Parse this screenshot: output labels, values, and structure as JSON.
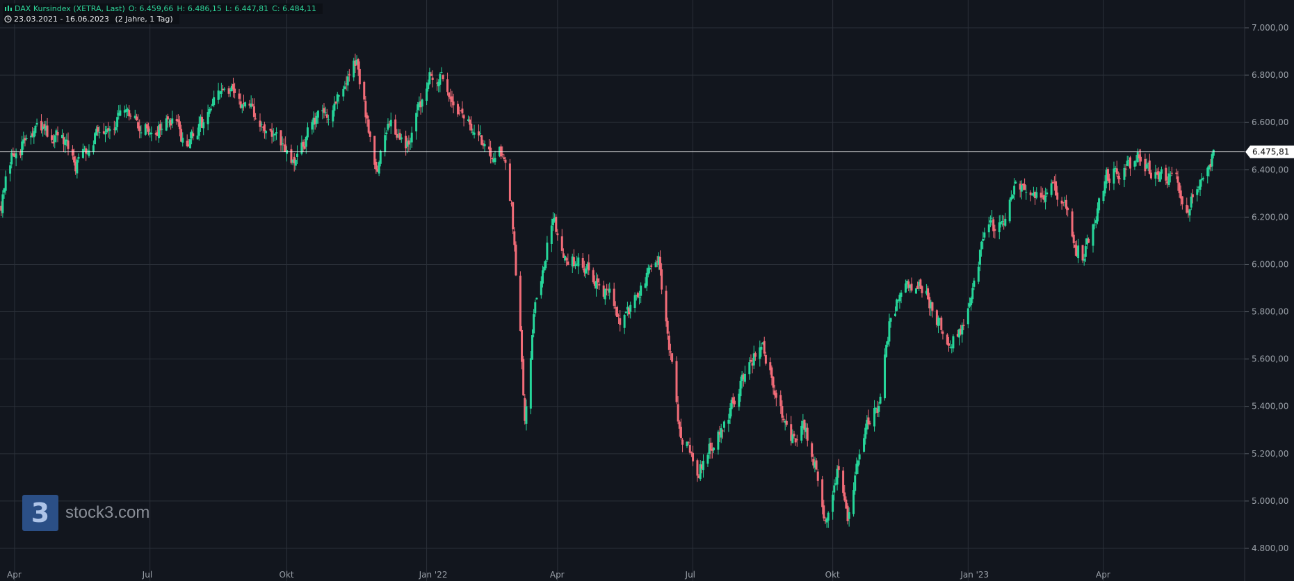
{
  "header": {
    "title": "DAX Kursindex (XETRA, Last)",
    "open": "O: 6.459,66",
    "high": "H: 6.486,15",
    "low": "L: 6.447,81",
    "close": "C: 6.484,11",
    "range": "23.03.2021 - 16.06.2023",
    "period": "(2 Jahre, 1 Tag)"
  },
  "watermark": {
    "text": "stock3.com",
    "logo": "3"
  },
  "colors": {
    "up": "#26d69a",
    "down": "#f26c78",
    "grid": "#2b3039",
    "background": "#12161e"
  },
  "chart_data": {
    "type": "candlestick",
    "title": "DAX Kursindex (XETRA, Last)",
    "ylim": [
      4800,
      7000
    ],
    "y_ticks": [
      4800,
      5000,
      5200,
      5400,
      5600,
      5800,
      6000,
      6200,
      6400,
      6600,
      6800,
      7000
    ],
    "y_tick_labels": [
      "4.800,00",
      "5.000,00",
      "5.200,00",
      "5.400,00",
      "5.600,00",
      "5.800,00",
      "6.000,00",
      "6.200,00",
      "6.400,00",
      "6.600,00",
      "6.800,00",
      "7.000,00"
    ],
    "x_ticks": [
      {
        "label": "Apr",
        "date": "2021-04-01"
      },
      {
        "label": "Jul",
        "date": "2021-07-01"
      },
      {
        "label": "Okt",
        "date": "2021-10-01"
      },
      {
        "label": "Jan '22",
        "date": "2022-01-03"
      },
      {
        "label": "Apr",
        "date": "2022-04-01"
      },
      {
        "label": "Jul",
        "date": "2022-07-01"
      },
      {
        "label": "Okt",
        "date": "2022-10-03"
      },
      {
        "label": "Jan '23",
        "date": "2023-01-02"
      },
      {
        "label": "Apr",
        "date": "2023-04-03"
      }
    ],
    "x_range": [
      "2021-03-23",
      "2023-06-16"
    ],
    "current_price": 6475.81,
    "current_price_label": "6.475,81",
    "last_candle": {
      "open": 6459.66,
      "high": 6486.15,
      "low": 6447.81,
      "close": 6484.11
    },
    "close_path": [
      [
        "2021-03-23",
        6260
      ],
      [
        "2021-04-01",
        6480
      ],
      [
        "2021-04-15",
        6560
      ],
      [
        "2021-04-30",
        6540
      ],
      [
        "2021-05-12",
        6420
      ],
      [
        "2021-05-25",
        6570
      ],
      [
        "2021-06-10",
        6620
      ],
      [
        "2021-06-30",
        6570
      ],
      [
        "2021-07-15",
        6600
      ],
      [
        "2021-07-27",
        6500
      ],
      [
        "2021-08-10",
        6640
      ],
      [
        "2021-08-20",
        6730
      ],
      [
        "2021-09-01",
        6690
      ],
      [
        "2021-09-10",
        6600
      ],
      [
        "2021-09-20",
        6560
      ],
      [
        "2021-09-30",
        6460
      ],
      [
        "2021-10-06",
        6400
      ],
      [
        "2021-10-15",
        6560
      ],
      [
        "2021-10-28",
        6640
      ],
      [
        "2021-11-10",
        6780
      ],
      [
        "2021-11-17",
        6850
      ],
      [
        "2021-11-26",
        6540
      ],
      [
        "2021-12-01",
        6400
      ],
      [
        "2021-12-10",
        6620
      ],
      [
        "2021-12-20",
        6510
      ],
      [
        "2021-12-30",
        6660
      ],
      [
        "2022-01-05",
        6830
      ],
      [
        "2022-01-20",
        6720
      ],
      [
        "2022-02-01",
        6580
      ],
      [
        "2022-02-10",
        6500
      ],
      [
        "2022-02-24",
        6480
      ],
      [
        "2022-03-01",
        6260
      ],
      [
        "2022-03-07",
        5700
      ],
      [
        "2022-03-10",
        5350
      ],
      [
        "2022-03-16",
        5800
      ],
      [
        "2022-03-29",
        6200
      ],
      [
        "2022-04-07",
        6020
      ],
      [
        "2022-04-20",
        6000
      ],
      [
        "2022-05-05",
        5880
      ],
      [
        "2022-05-12",
        5750
      ],
      [
        "2022-05-20",
        5800
      ],
      [
        "2022-06-01",
        5960
      ],
      [
        "2022-06-08",
        6000
      ],
      [
        "2022-06-16",
        5600
      ],
      [
        "2022-06-22",
        5300
      ],
      [
        "2022-07-01",
        5200
      ],
      [
        "2022-07-05",
        5130
      ],
      [
        "2022-07-15",
        5260
      ],
      [
        "2022-07-28",
        5420
      ],
      [
        "2022-08-10",
        5600
      ],
      [
        "2022-08-16",
        5660
      ],
      [
        "2022-08-29",
        5400
      ],
      [
        "2022-09-05",
        5220
      ],
      [
        "2022-09-13",
        5330
      ],
      [
        "2022-09-21",
        5150
      ],
      [
        "2022-09-29",
        4900
      ],
      [
        "2022-10-06",
        5100
      ],
      [
        "2022-10-13",
        4950
      ],
      [
        "2022-10-24",
        5280
      ],
      [
        "2022-11-03",
        5420
      ],
      [
        "2022-11-11",
        5800
      ],
      [
        "2022-11-22",
        5900
      ],
      [
        "2022-12-01",
        5930
      ],
      [
        "2022-12-12",
        5790
      ],
      [
        "2022-12-20",
        5680
      ],
      [
        "2022-12-30",
        5720
      ],
      [
        "2023-01-06",
        5950
      ],
      [
        "2023-01-13",
        6130
      ],
      [
        "2023-01-25",
        6170
      ],
      [
        "2023-02-02",
        6310
      ],
      [
        "2023-02-14",
        6290
      ],
      [
        "2023-02-28",
        6310
      ],
      [
        "2023-03-08",
        6300
      ],
      [
        "2023-03-13",
        6100
      ],
      [
        "2023-03-20",
        6040
      ],
      [
        "2023-03-30",
        6220
      ],
      [
        "2023-04-05",
        6360
      ],
      [
        "2023-04-18",
        6430
      ],
      [
        "2023-04-28",
        6450
      ],
      [
        "2023-05-05",
        6400
      ],
      [
        "2023-05-15",
        6380
      ],
      [
        "2023-05-24",
        6320
      ],
      [
        "2023-05-31",
        6240
      ],
      [
        "2023-06-05",
        6340
      ],
      [
        "2023-06-10",
        6400
      ],
      [
        "2023-06-16",
        6484
      ]
    ]
  }
}
